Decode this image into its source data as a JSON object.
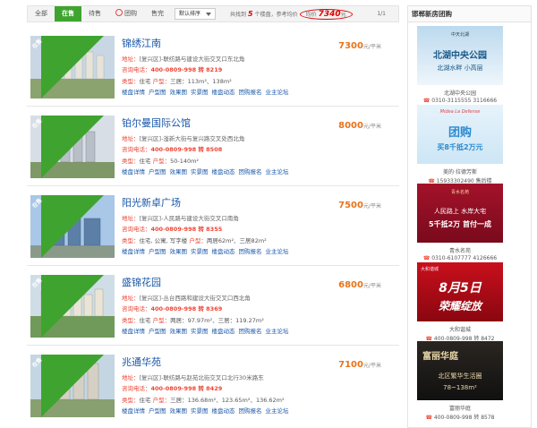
{
  "tabs": [
    {
      "label": "全部",
      "active": false
    },
    {
      "label": "在售",
      "active": true
    },
    {
      "label": "待售",
      "active": false
    },
    {
      "label": "团购",
      "active": false
    },
    {
      "label": "售完",
      "active": false
    }
  ],
  "sort": {
    "label": "默认排序"
  },
  "summary": {
    "prefix": "共找到",
    "count": "5",
    "unit": "个楼盘，参考均价",
    "avg_label": "均价",
    "avg_value": "7340",
    "avg_unit": "元"
  },
  "pager": "1/1",
  "labels": {
    "addr": "地址：",
    "tel": "咨询电话：",
    "type": "类型：",
    "layout": "户型：",
    "price_unit": "元/平米"
  },
  "link_labels": [
    "楼盘详情",
    "户型图",
    "效果图",
    "实景图",
    "楼盘动态",
    "团购报名",
    "业主论坛"
  ],
  "listings": [
    {
      "name": "锦绣江南",
      "badge": "在售",
      "price": "7300",
      "address": "[复兴区]-联纺路与建设大街交叉口东北角",
      "phone": "400-0809-998 转 8219",
      "type": "住宅",
      "layout": "三居：113m²、138m²"
    },
    {
      "name": "铂尔曼国际公馆",
      "badge": "在售",
      "price": "8000",
      "address": "[复兴区]-滏新大街与复兴路交叉处西北角",
      "phone": "400-0809-998 转 8508",
      "type": "住宅",
      "layout": "50-140m²"
    },
    {
      "name": "阳光新卓广场",
      "badge": "在售",
      "price": "7500",
      "address": "[复兴区]-人民路与建设大街交叉口南角",
      "phone": "400-0809-998 转 8355",
      "type": "住宅, 公寓, 写字楼",
      "layout": "两居62m²、三居82m²"
    },
    {
      "name": "盛锦花园",
      "badge": "在售",
      "price": "6800",
      "address": "[复兴区]-丛台西路和建设大街交叉口西北角",
      "phone": "400-0809-998 转 8369",
      "type": "住宅",
      "layout": "两居：97.97m²、三居：119.27m²"
    },
    {
      "name": "兆通华苑",
      "badge": "在售",
      "price": "7100",
      "address": "[复兴区]-联纺路与赵苑北街交叉口北行30米路东",
      "phone": "400-0809-998 转 8429",
      "type": "住宅",
      "layout": "三居：136.68m²、123.65m²、136.62m²"
    }
  ],
  "sidebar": {
    "title": "邯郸新房团购",
    "ads": [
      {
        "name": "北湖中央公园",
        "phone": "0310-3115555 3116666",
        "headline": "北湖中央公园",
        "sub": "北湖水畔 小高层",
        "brand": "中天北湖"
      },
      {
        "name": "美的·拉德芳斯",
        "phone": "15933302490 售后楼",
        "headline": "团购",
        "sub": "买8千抵2万元",
        "brand": "Midea La Defense"
      },
      {
        "name": "青水名苑",
        "phone": "0310-6107777 4126666",
        "headline": "人民路上 水岸大宅",
        "sub": "5千抵2万 首付一成",
        "brand": "青水名苑"
      },
      {
        "name": "大和谐城",
        "phone": "400-0809-998 转 8472",
        "headline": "8月5日",
        "sub": "荣耀绽放",
        "brand": "大和谐城"
      },
      {
        "name": "富丽华庭",
        "phone": "400-0809-998 转 8578",
        "headline": "北区繁华生活圈",
        "sub": "78~138m²",
        "brand": "富丽华庭"
      }
    ]
  },
  "colors": {
    "accent_green": "#3ea42f",
    "link_blue": "#1a57a8",
    "price_orange": "#e8741c",
    "label_red": "#e43"
  }
}
